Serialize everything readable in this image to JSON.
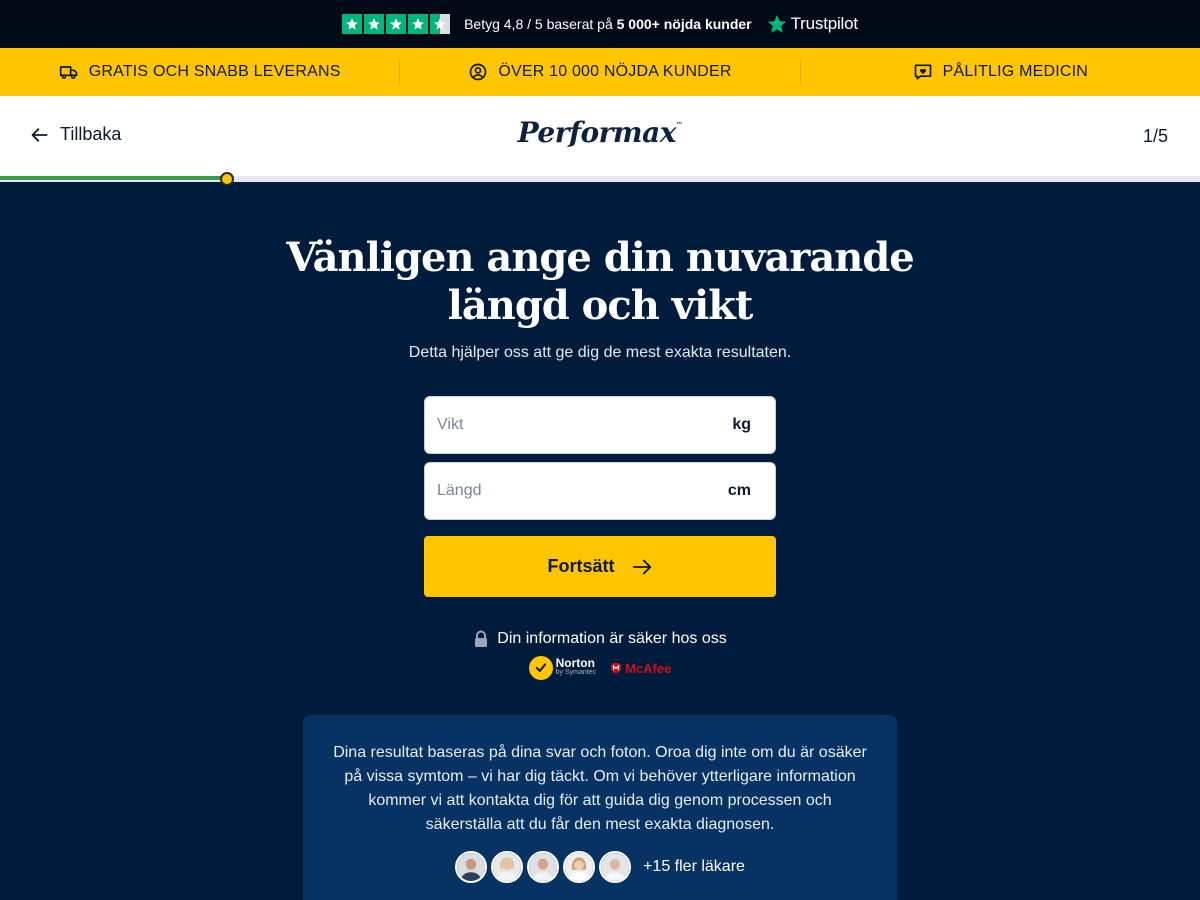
{
  "trustpilot": {
    "rating_prefix": "Betyg 4,8 / 5 baserat på",
    "rating_highlight": "5 000+ nöjda kunder",
    "brand": "Trustpilot",
    "stars": 4.5
  },
  "benefits": [
    {
      "icon": "truck-icon",
      "label": "GRATIS OCH SNABB LEVERANS"
    },
    {
      "icon": "user-circle-icon",
      "label": "ÖVER 10 000 NÖJDA KUNDER"
    },
    {
      "icon": "heart-message-icon",
      "label": "PÅLITLIG MEDICIN"
    }
  ],
  "header": {
    "back_label": "Tillbaka",
    "logo": "Performax",
    "logo_tm": "™",
    "step": "1/5"
  },
  "progress": {
    "value": 0.19
  },
  "main": {
    "title": "Vänligen ange din nuvarande längd och vikt",
    "subtitle": "Detta hjälper oss att ge dig de mest exakta resultaten.",
    "weight": {
      "placeholder": "Vikt",
      "value": "",
      "unit": "kg"
    },
    "height": {
      "placeholder": "Längd",
      "value": "",
      "unit": "cm"
    },
    "cta_label": "Fortsätt",
    "secure_text": "Din information är säker hos oss",
    "norton": {
      "name": "Norton",
      "sub": "by Symantec"
    },
    "mcafee": "McAfee"
  },
  "info": {
    "text": "Dina resultat baseras på dina svar och foton. Oroa dig inte om du är osäker på vissa symtom – vi har dig täckt. Om vi behöver ytterligare information kommer vi att kontakta dig för att guida dig genom processen och säkerställa att du får den mest exakta diagnosen.",
    "more_doctors": "+15 fler läkare"
  },
  "colors": {
    "background": "#001c3d",
    "accent": "#ffc501",
    "trustpilot_green": "#00b67a",
    "progress": "#3c9c4e",
    "info_box": "#063363"
  }
}
